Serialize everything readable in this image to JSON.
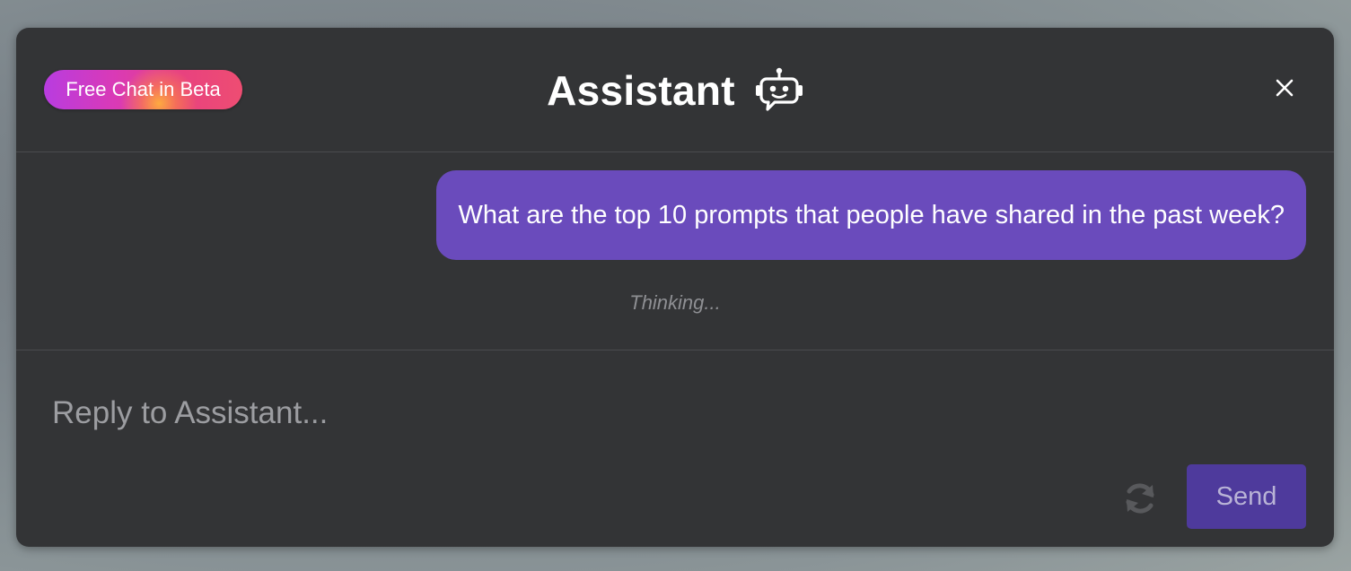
{
  "header": {
    "badge_label": "Free Chat in Beta",
    "title": "Assistant",
    "title_icon": "robot-chat-icon",
    "close_icon": "close-icon"
  },
  "chat": {
    "messages": [
      {
        "role": "user",
        "text": "What are the top 10 prompts that people have shared in the past week?"
      }
    ],
    "status_text": "Thinking..."
  },
  "composer": {
    "placeholder": "Reply to Assistant...",
    "value": "",
    "refresh_icon": "refresh-icon",
    "send_label": "Send"
  },
  "colors": {
    "modal_bg": "#333436",
    "user_bubble": "#6a4bbc",
    "send_button": "#4e3a9c",
    "badge_gradient_start": "#b83ce0",
    "badge_gradient_end": "#ee4d72"
  }
}
